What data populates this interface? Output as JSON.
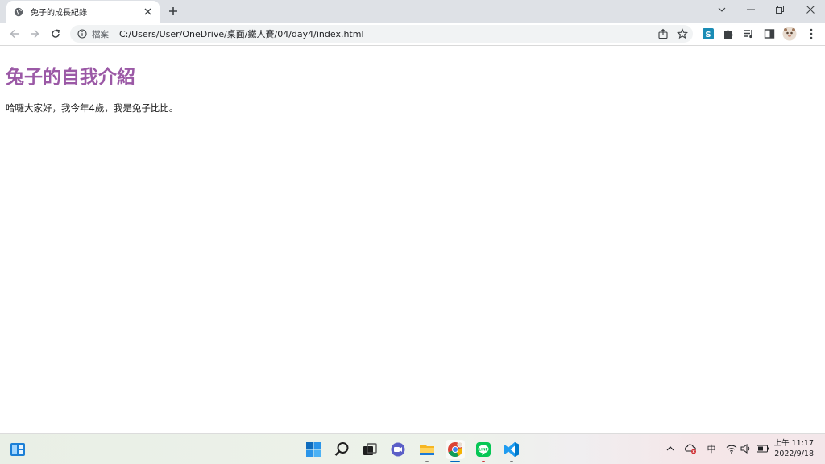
{
  "browser": {
    "tab_title": "兔子的成長紀錄",
    "scheme_label": "檔案",
    "url": "C:/Users/User/OneDrive/桌面/鐵人賽/04/day4/index.html"
  },
  "page": {
    "heading": "兔子的自我介紹",
    "paragraph": "哈囉大家好，我今年4歲，我是兔子比比。",
    "heading_color": "#9b59a6"
  },
  "taskbar": {
    "apps": [
      "widgets-icon",
      "start-icon",
      "search-icon",
      "task-view-icon",
      "chat-icon",
      "file-explorer-icon",
      "chrome-icon",
      "line-icon",
      "vscode-icon"
    ],
    "ime_label": "中",
    "clock_time": "上午 11:17",
    "clock_date": "2022/9/18"
  }
}
